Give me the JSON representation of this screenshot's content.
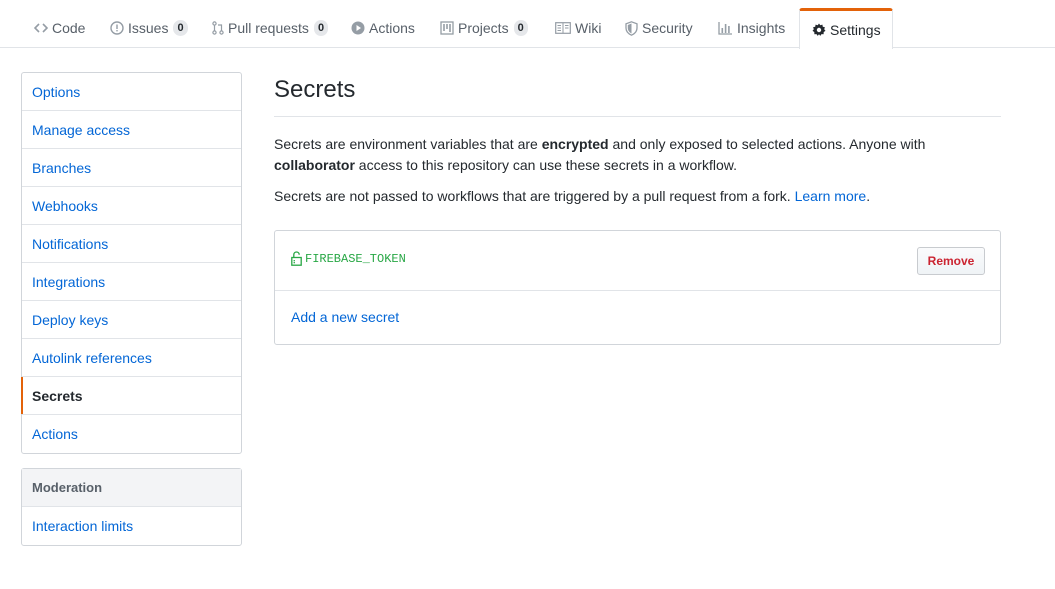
{
  "tabs": [
    {
      "label": "Code",
      "icon": "code-icon"
    },
    {
      "label": "Issues",
      "icon": "issue-opened-icon",
      "count": "0"
    },
    {
      "label": "Pull requests",
      "icon": "git-pull-request-icon",
      "count": "0"
    },
    {
      "label": "Actions",
      "icon": "play-icon"
    },
    {
      "label": "Projects",
      "icon": "project-icon",
      "count": "0"
    },
    {
      "label": "Wiki",
      "icon": "book-icon"
    },
    {
      "label": "Security",
      "icon": "shield-icon"
    },
    {
      "label": "Insights",
      "icon": "graph-icon"
    },
    {
      "label": "Settings",
      "icon": "gear-icon",
      "selected": true
    }
  ],
  "sidebar": {
    "items": [
      {
        "label": "Options"
      },
      {
        "label": "Manage access"
      },
      {
        "label": "Branches"
      },
      {
        "label": "Webhooks"
      },
      {
        "label": "Notifications"
      },
      {
        "label": "Integrations"
      },
      {
        "label": "Deploy keys"
      },
      {
        "label": "Autolink references"
      },
      {
        "label": "Secrets",
        "selected": true
      },
      {
        "label": "Actions"
      }
    ],
    "moderation": {
      "heading": "Moderation",
      "items": [
        {
          "label": "Interaction limits"
        }
      ]
    }
  },
  "main": {
    "title": "Secrets",
    "intro": {
      "part1": "Secrets are environment variables that are ",
      "bold1": "encrypted",
      "part2": " and only exposed to selected actions. Anyone with ",
      "bold2": "collaborator",
      "part3": " access to this repository can use these secrets in a workflow."
    },
    "fork_note": {
      "text": "Secrets are not passed to workflows that are triggered by a pull request from a fork. ",
      "link": "Learn more",
      "end": "."
    },
    "secrets": [
      {
        "name": "FIREBASE_TOKEN",
        "remove_label": "Remove"
      }
    ],
    "add_label": "Add a new secret"
  },
  "colors": {
    "accent": "#e36209",
    "link": "#0366d6",
    "secret_green": "#28a745",
    "danger": "#cb2431"
  }
}
